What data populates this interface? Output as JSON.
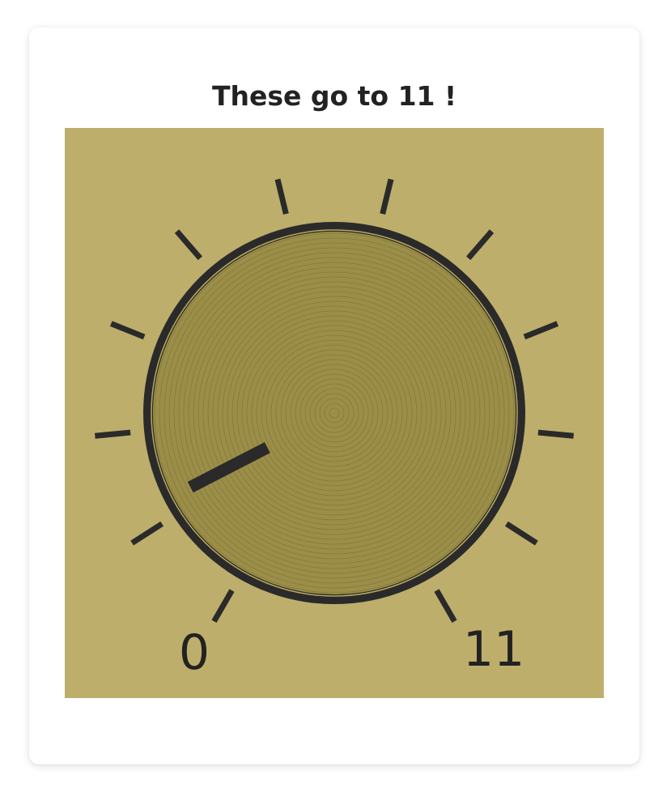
{
  "card": {
    "title": "These go to 11 !"
  },
  "knob": {
    "min_label": "0",
    "max_label": "11",
    "min": 0,
    "max": 11,
    "value": 1.2
  },
  "colors": {
    "panel_background": "#bdae6b",
    "knob_face": "#9b8e48",
    "knob_rings": "#857a3a",
    "rim": "#2a2a2a",
    "inner_rim": "#b8a85e",
    "tick": "#2a2a2a",
    "pointer": "#2a2a2a"
  }
}
